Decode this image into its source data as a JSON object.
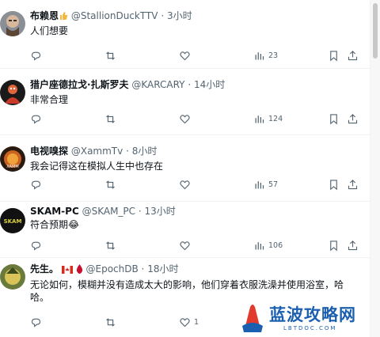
{
  "tweets": [
    {
      "name": "布赖恩",
      "handle": "@StallionDuckTTV",
      "time": "3小时",
      "text": "人们想要",
      "views": "23",
      "name_badge": "👍",
      "avatar_desc": "bald man with beard"
    },
    {
      "name": "猎户座德拉戈·扎斯罗夫",
      "handle": "@KARCARY",
      "time": "14小时",
      "text": "非常合理",
      "views": "124"
    },
    {
      "name": "电视嗅探",
      "handle": "@XammTv",
      "time": "8小时",
      "text": "我会记得这在模拟人生中也存在",
      "views": "57"
    },
    {
      "name": "SKAM-PC",
      "handle": "@SKAM_PC",
      "time": "13小时",
      "text": "符合预期😂",
      "views": "106"
    },
    {
      "name": "先生。",
      "handle": "@EpochDB",
      "time": "18小时",
      "text_line1": "无论如何，模糊并没有造成太大的影响，他们穿着衣服洗澡并使用浴室，哈",
      "text_line2": "哈。",
      "likes": "1"
    }
  ],
  "separator": "·",
  "watermark": {
    "title": "蓝波攻略网",
    "subtitle": "LBTDOC.COM"
  },
  "colors": {
    "text": "#0f1419",
    "secondary": "#536471",
    "divider": "#eff3f4",
    "watermark": "#1b5fb0"
  }
}
